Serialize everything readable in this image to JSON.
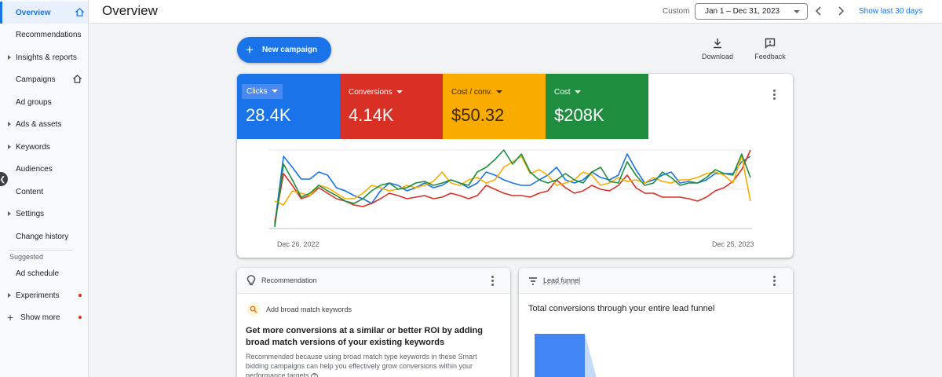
{
  "sidebar": {
    "items": [
      {
        "label": "Overview",
        "active": true,
        "home": true
      },
      {
        "label": "Recommendations"
      },
      {
        "label": "Insights & reports",
        "expandable": true
      },
      {
        "label": "Campaigns",
        "home": true
      },
      {
        "label": "Ad groups"
      },
      {
        "label": "Ads & assets",
        "expandable": true
      },
      {
        "label": "Keywords",
        "expandable": true
      },
      {
        "label": "Audiences"
      },
      {
        "label": "Content"
      },
      {
        "label": "Settings",
        "expandable": true
      },
      {
        "label": "Change history"
      }
    ],
    "suggested_label": "Suggested",
    "suggested_items": [
      {
        "label": "Ad schedule"
      },
      {
        "label": "Experiments",
        "expandable": true,
        "dot": true
      }
    ],
    "show_more": "Show more"
  },
  "header": {
    "title": "Overview",
    "range_label": "Custom",
    "range_value": "Jan 1 – Dec 31, 2023",
    "show_last": "Show last 30 days"
  },
  "toolbar": {
    "new_campaign": "New campaign",
    "download": "Download",
    "feedback": "Feedback"
  },
  "metrics": [
    {
      "label": "Clicks",
      "value": "28.4K",
      "color": "#1a73e8"
    },
    {
      "label": "Conversions",
      "value": "4.14K",
      "color": "#d93025"
    },
    {
      "label": "Cost / conv.",
      "value": "$50.32",
      "color": "#f9ab00"
    },
    {
      "label": "Cost",
      "value": "$208K",
      "color": "#1e8e3e"
    }
  ],
  "chart_data": {
    "type": "line",
    "x_start": "Dec 26, 2022",
    "x_end": "Dec 25, 2023",
    "series": [
      {
        "name": "Clicks",
        "color": "#1a73e8",
        "values": [
          0.05,
          0.92,
          0.78,
          0.63,
          0.63,
          0.72,
          0.68,
          0.52,
          0.48,
          0.42,
          0.38,
          0.32,
          0.48,
          0.58,
          0.55,
          0.48,
          0.52,
          0.58,
          0.52,
          0.55,
          0.62,
          0.58,
          0.52,
          0.58,
          0.72,
          0.68,
          0.62,
          0.58,
          0.55,
          0.55,
          0.62,
          0.68,
          0.78,
          0.62,
          0.58,
          0.62,
          0.72,
          0.65,
          0.62,
          0.68,
          0.95,
          0.75,
          0.58,
          0.62,
          0.68,
          0.72,
          0.58,
          0.6,
          0.58,
          0.62,
          0.7,
          0.7,
          0.7,
          0.85,
          0.92
        ]
      },
      {
        "name": "Conversions",
        "color": "#d93025",
        "values": [
          0.08,
          0.7,
          0.55,
          0.38,
          0.42,
          0.52,
          0.45,
          0.38,
          0.35,
          0.3,
          0.28,
          0.32,
          0.38,
          0.45,
          0.42,
          0.38,
          0.4,
          0.42,
          0.38,
          0.4,
          0.45,
          0.42,
          0.38,
          0.42,
          0.55,
          0.5,
          0.45,
          0.42,
          0.42,
          0.4,
          0.45,
          0.48,
          0.62,
          0.52,
          0.45,
          0.48,
          0.55,
          0.5,
          0.48,
          0.55,
          0.68,
          0.52,
          0.45,
          0.45,
          0.4,
          0.4,
          0.4,
          0.38,
          0.35,
          0.4,
          0.48,
          0.52,
          0.6,
          0.75,
          1.0
        ]
      },
      {
        "name": "Cost / conv.",
        "color": "#f9ab00",
        "values": [
          0.35,
          0.3,
          0.48,
          0.45,
          0.42,
          0.55,
          0.52,
          0.45,
          0.38,
          0.38,
          0.45,
          0.55,
          0.52,
          0.48,
          0.5,
          0.55,
          0.52,
          0.55,
          0.6,
          0.72,
          0.58,
          0.55,
          0.62,
          0.65,
          0.58,
          0.62,
          0.78,
          0.85,
          0.92,
          0.7,
          0.75,
          0.68,
          0.55,
          0.58,
          0.62,
          0.72,
          0.68,
          0.55,
          0.58,
          0.65,
          0.6,
          0.62,
          0.58,
          0.65,
          0.6,
          0.58,
          0.62,
          0.62,
          0.65,
          0.7,
          0.72,
          0.68,
          0.58,
          0.92,
          0.35
        ]
      },
      {
        "name": "Cost",
        "color": "#1e8e3e",
        "values": [
          0.02,
          0.82,
          0.62,
          0.4,
          0.45,
          0.55,
          0.48,
          0.42,
          0.35,
          0.32,
          0.38,
          0.48,
          0.55,
          0.58,
          0.5,
          0.52,
          0.58,
          0.6,
          0.55,
          0.58,
          0.62,
          0.58,
          0.55,
          0.72,
          0.78,
          0.88,
          1.0,
          0.82,
          0.95,
          0.72,
          0.62,
          0.58,
          0.62,
          0.7,
          0.62,
          0.58,
          0.72,
          0.78,
          0.6,
          0.58,
          0.85,
          0.68,
          0.55,
          0.58,
          0.72,
          0.65,
          0.55,
          0.58,
          0.58,
          0.65,
          0.75,
          0.7,
          0.68,
          0.95,
          0.65
        ]
      }
    ]
  },
  "recommendation": {
    "header": "Recommendation",
    "sub": "Add broad match keywords",
    "title": "Get more conversions at a similar or better ROI by adding broad match versions of your existing keywords",
    "body": "Recommended because using broad match type keywords in these Smart bidding campaigns can help you effectively grow conversions within your performance targets"
  },
  "funnel": {
    "header": "Lead funnel",
    "title": "Total conversions through your entire lead funnel"
  }
}
